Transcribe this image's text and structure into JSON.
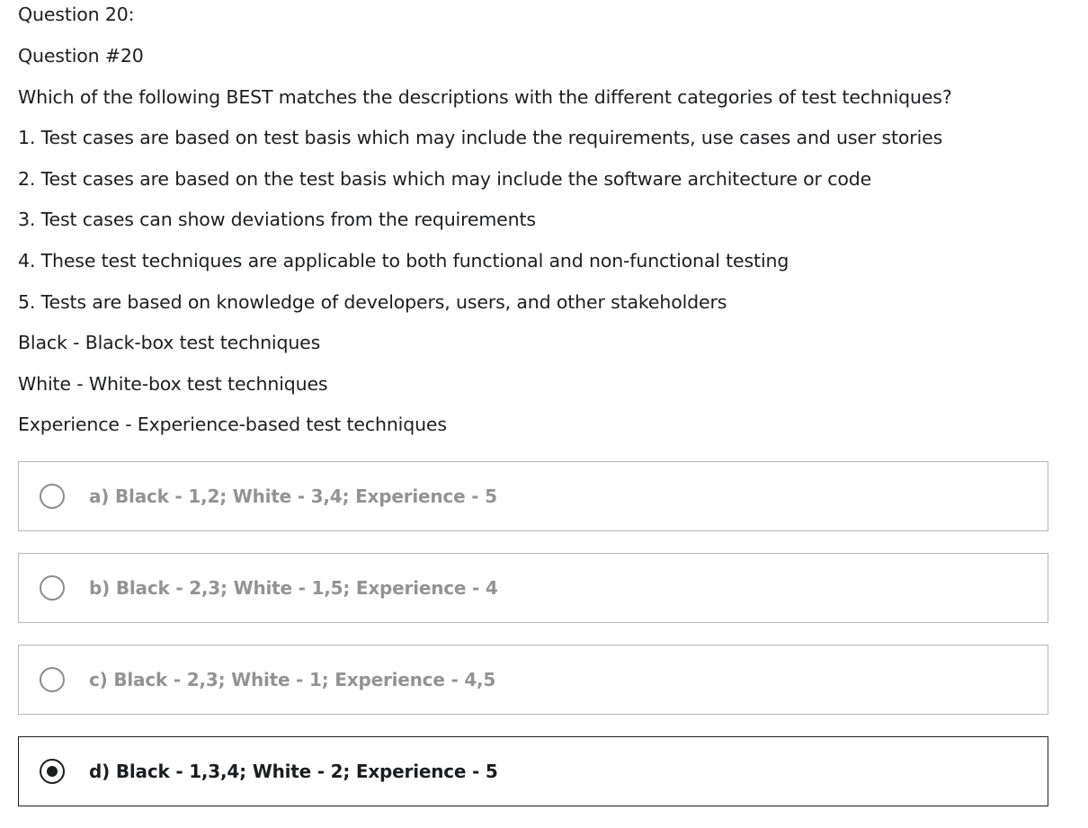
{
  "question": {
    "header": "Question 20:",
    "number": "Question #20",
    "prompt": "Which of the following BEST matches the descriptions with the different categories of test techniques?",
    "statements": [
      "1. Test cases are based on test basis which may include the requirements, use cases and user stories",
      "2. Test cases are based on the test basis which may include the software architecture or code",
      "3. Test cases can show deviations from the requirements",
      "4. These test techniques are applicable to both functional and non-functional testing",
      "5. Tests are based on knowledge of developers, users, and other stakeholders"
    ],
    "legend": [
      "Black - Black-box test techniques",
      "White - White-box test techniques",
      "Experience - Experience-based test techniques"
    ]
  },
  "options": [
    {
      "label": "a) Black - 1,2; White - 3,4; Experience - 5",
      "selected": false
    },
    {
      "label": "b) Black - 2,3; White - 1,5; Experience - 4",
      "selected": false
    },
    {
      "label": "c) Black - 2,3; White - 1; Experience - 4,5",
      "selected": false
    },
    {
      "label": "d) Black - 1,3,4; White - 2; Experience - 5",
      "selected": true
    }
  ]
}
